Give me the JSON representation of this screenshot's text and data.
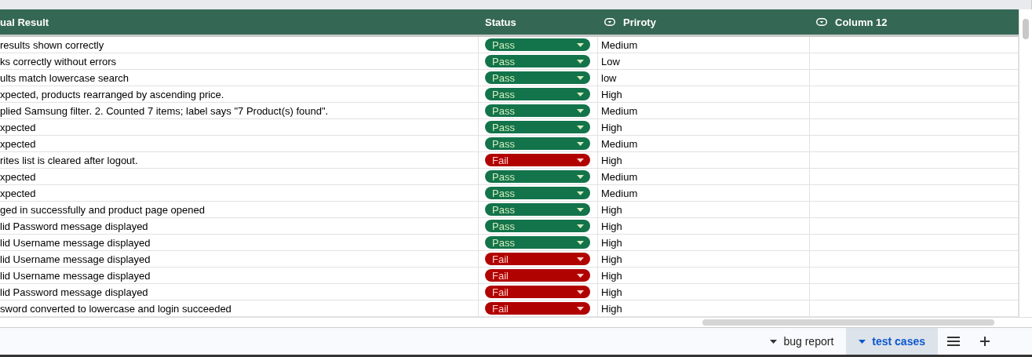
{
  "table": {
    "columns": [
      {
        "label": "ual Result",
        "icon": false
      },
      {
        "label": "Status",
        "icon": false
      },
      {
        "label": "Priroty",
        "icon": true
      },
      {
        "label": "Column 12",
        "icon": true
      }
    ],
    "rows": [
      {
        "result": "results shown correctly",
        "status": {
          "label": "Pass",
          "kind": "pass"
        },
        "priority": "Medium"
      },
      {
        "result": "ks correctly without errors",
        "status": {
          "label": "Pass",
          "kind": "pass"
        },
        "priority": "Low"
      },
      {
        "result": "ults match lowercase search",
        "status": {
          "label": "Pass",
          "kind": "pass"
        },
        "priority": "low"
      },
      {
        "result": "xpected, products rearranged by ascending price.",
        "status": {
          "label": "Pass",
          "kind": "pass"
        },
        "priority": "High"
      },
      {
        "result": "plied Samsung filter. 2. Counted 7 items; label says \"7 Product(s) found\".",
        "status": {
          "label": "Pass",
          "kind": "pass"
        },
        "priority": "Medium"
      },
      {
        "result": "xpected",
        "status": {
          "label": "Pass",
          "kind": "pass"
        },
        "priority": "High"
      },
      {
        "result": "xpected",
        "status": {
          "label": "Pass",
          "kind": "pass"
        },
        "priority": "Medium"
      },
      {
        "result": "rites list is cleared after logout.",
        "status": {
          "label": "Fail",
          "kind": "fail"
        },
        "priority": "High"
      },
      {
        "result": "xpected",
        "status": {
          "label": "Pass",
          "kind": "pass"
        },
        "priority": "Medium"
      },
      {
        "result": "xpected",
        "status": {
          "label": "Pass",
          "kind": "pass"
        },
        "priority": "Medium"
      },
      {
        "result": "ged in successfully and product page opened",
        "status": {
          "label": "Pass",
          "kind": "pass"
        },
        "priority": "High"
      },
      {
        "result": "lid Password message displayed",
        "status": {
          "label": "Pass",
          "kind": "pass"
        },
        "priority": "High"
      },
      {
        "result": "lid Username message displayed",
        "status": {
          "label": "Pass",
          "kind": "pass"
        },
        "priority": "High"
      },
      {
        "result": "lid Username message displayed",
        "status": {
          "label": "Fail",
          "kind": "fail"
        },
        "priority": "High"
      },
      {
        "result": "lid Username message displayed",
        "status": {
          "label": "Fail",
          "kind": "fail"
        },
        "priority": "High"
      },
      {
        "result": "lid Password message displayed",
        "status": {
          "label": "Fail",
          "kind": "fail"
        },
        "priority": "High"
      },
      {
        "result": "sword converted to lowercase and login succeeded",
        "status": {
          "label": "Fail",
          "kind": "fail"
        },
        "priority": "High"
      }
    ]
  },
  "sheet_tabs": [
    {
      "label": "bug report",
      "selected": false
    },
    {
      "label": "test cases",
      "selected": true
    }
  ]
}
